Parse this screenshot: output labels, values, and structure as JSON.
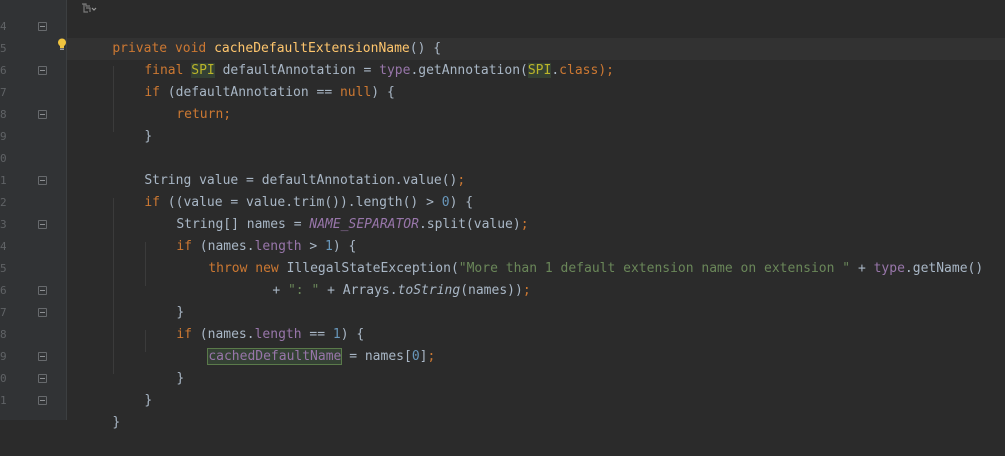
{
  "gutter": {
    "line_numbers": [
      "4",
      "5",
      "6",
      "7",
      "8",
      "9",
      "0",
      "1",
      "2",
      "3",
      "4",
      "5",
      "6",
      "7",
      "8",
      "9",
      "0",
      "1"
    ]
  },
  "code": {
    "l0": {
      "kw1": "private",
      "kw2": "void",
      "fn": "cacheDefaultExtensionName",
      "rest": "() {"
    },
    "l1": {
      "kw": "final",
      "type": "SPI",
      "mid": " defaultAnnotation = ",
      "field": "type",
      "call": ".getAnnotation(",
      "an": "SPI",
      "dot": ".",
      "cls": "class",
      "end": ");"
    },
    "l2": {
      "kw": "if",
      "mid": " (defaultAnnotation == ",
      "nul": "null",
      "end": ") {"
    },
    "l3": {
      "kw": "return",
      "end": ";"
    },
    "l4": {
      "text": "}"
    },
    "l5": {
      "text": "String value = defaultAnnotation.value()",
      "end": ";"
    },
    "l6": {
      "kw": "if",
      "mid": " ((value = value.trim()).length() > ",
      "num": "0",
      "end": ") {"
    },
    "l7": {
      "a": "String[] names = ",
      "const": "NAME_SEPARATOR",
      "b": ".split(value)",
      "end": ";"
    },
    "l8": {
      "kw": "if",
      "a": " (names.",
      "field": "length",
      "b": " > ",
      "num": "1",
      "end": ") {"
    },
    "l9": {
      "kw1": "throw",
      "kw2": "new",
      "a": " IllegalStateException(",
      "str": "\"More than 1 default extension name on extension \"",
      "b": " + ",
      "field": "type",
      "c": ".getName()"
    },
    "l10": {
      "a": "+ ",
      "str": "\": \"",
      "b": " + Arrays.",
      "ital": "toString",
      "c": "(names))",
      "end": ";"
    },
    "l11": {
      "text": "}"
    },
    "l12": {
      "kw": "if",
      "a": " (names.",
      "field": "length",
      "b": " == ",
      "num": "1",
      "end": ") {"
    },
    "l13": {
      "cached": "cachedDefaultName",
      "a": " = names[",
      "num": "0",
      "b": "]",
      "end": ";"
    },
    "l14": {
      "text": "}"
    },
    "l15": {
      "text": "}"
    },
    "l16": {
      "text": "}"
    }
  },
  "colors": {
    "keyword": "#cc7832",
    "function": "#ffc66d",
    "annotation": "#bbb529",
    "number": "#6897bb",
    "string": "#6a8759",
    "field": "#9876aa"
  },
  "icons": {
    "bulb": "lightbulb-icon",
    "hint": "code-vision-icon"
  }
}
